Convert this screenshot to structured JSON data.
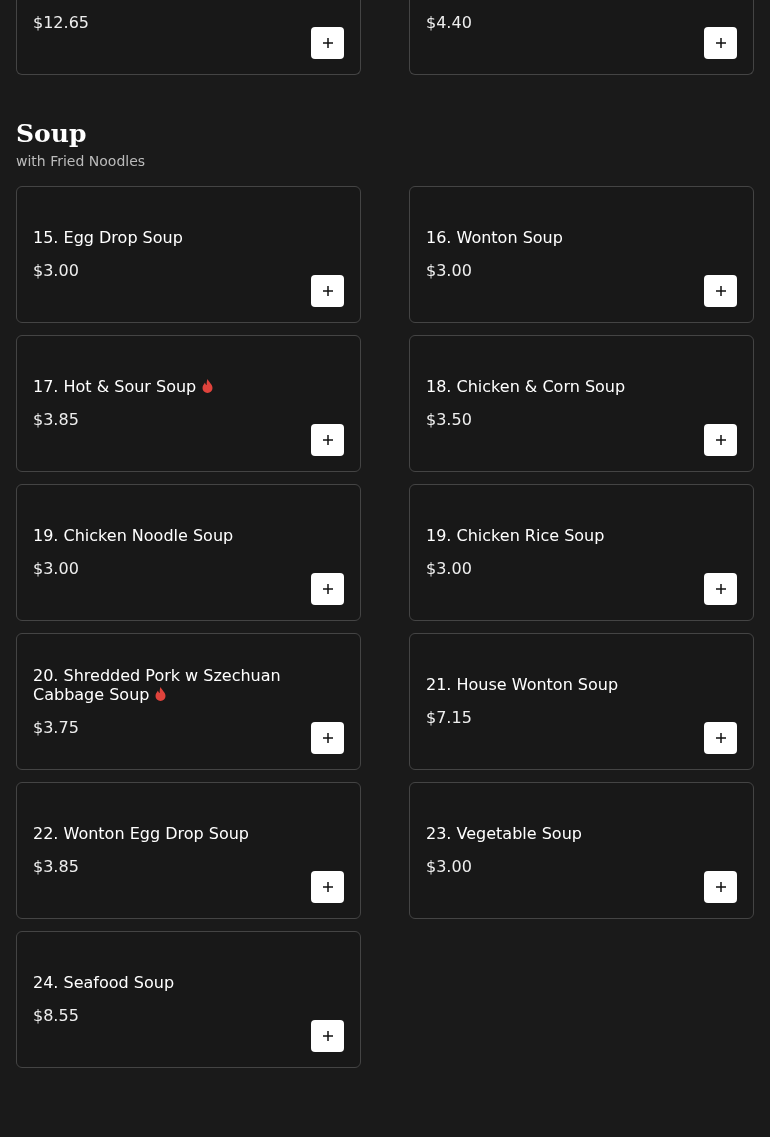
{
  "previous_items": [
    {
      "price": "$12.65"
    },
    {
      "price": "$4.40"
    }
  ],
  "section": {
    "title": "Soup",
    "subtitle": "with Fried Noodles",
    "items": [
      {
        "name": "15. Egg Drop Soup",
        "price": "$3.00",
        "spicy": false
      },
      {
        "name": "16. Wonton Soup",
        "price": "$3.00",
        "spicy": false
      },
      {
        "name": "17. Hot & Sour Soup",
        "price": "$3.85",
        "spicy": true
      },
      {
        "name": "18. Chicken & Corn Soup",
        "price": "$3.50",
        "spicy": false
      },
      {
        "name": "19. Chicken Noodle Soup",
        "price": "$3.00",
        "spicy": false
      },
      {
        "name": "19. Chicken Rice Soup",
        "price": "$3.00",
        "spicy": false
      },
      {
        "name": "20. Shredded Pork w Szechuan Cabbage Soup",
        "price": "$3.75",
        "spicy": true
      },
      {
        "name": "21. House Wonton Soup",
        "price": "$7.15",
        "spicy": false
      },
      {
        "name": "22. Wonton Egg Drop Soup",
        "price": "$3.85",
        "spicy": false
      },
      {
        "name": "23. Vegetable Soup",
        "price": "$3.00",
        "spicy": false
      },
      {
        "name": "24. Seafood Soup",
        "price": "$8.55",
        "spicy": false
      }
    ]
  }
}
